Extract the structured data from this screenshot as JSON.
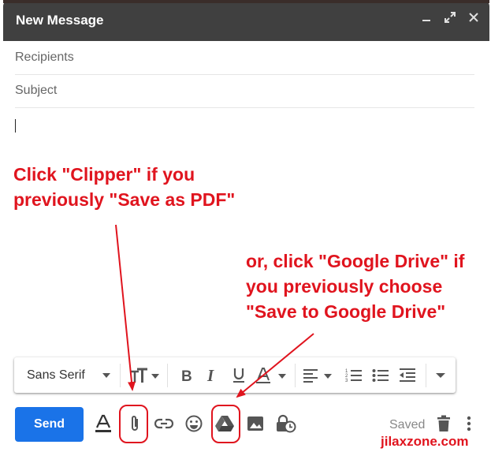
{
  "window": {
    "title": "New Message",
    "icons": [
      "minimize-icon",
      "expand-icon",
      "close-icon"
    ]
  },
  "fields": {
    "recipients_placeholder": "Recipients",
    "subject_placeholder": "Subject"
  },
  "annotations": {
    "left": "Click \"Clipper\" if you\npreviously \"Save as PDF\"",
    "right": "or, click \"Google Drive\" if\nyou previously choose\n\"Save to Google Drive\""
  },
  "format_toolbar": {
    "font": "Sans Serif"
  },
  "bottom_toolbar": {
    "send_label": "Send",
    "saved_label": "Saved"
  },
  "watermark": "jilaxzone.com",
  "colors": {
    "header": "#404040",
    "send": "#1a73e8",
    "annotation": "#e0141e"
  }
}
